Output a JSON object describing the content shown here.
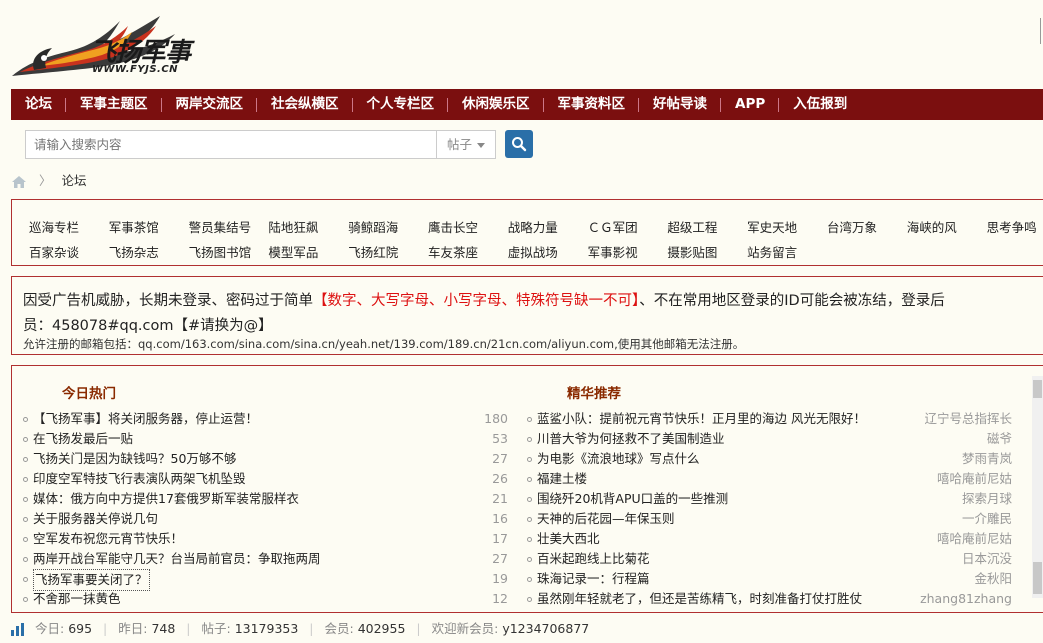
{
  "logo": {
    "title": "飞扬军事",
    "subtitle": "WWW.FYJS.CN"
  },
  "nav": [
    "论坛",
    "军事主题区",
    "两岸交流区",
    "社会纵横区",
    "个人专栏区",
    "休闲娱乐区",
    "军事资料区",
    "好帖导读",
    "APP",
    "入伍报到"
  ],
  "search": {
    "placeholder": "请输入搜索内容",
    "type": "帖子"
  },
  "breadcrumb": {
    "current": "论坛"
  },
  "categories": {
    "row1": [
      "巡海专栏",
      "军事茶馆",
      "警员集结号",
      "陆地狂飙",
      "骑鲸蹈海",
      "鹰击长空",
      "战略力量",
      "ＣＧ军团",
      "超级工程",
      "军史天地",
      "台湾万象",
      "海峡的风",
      "思考争鸣"
    ],
    "row2": [
      "百家杂谈",
      "飞扬杂志",
      "飞扬图书馆",
      "模型军品",
      "飞扬红院",
      "车友茶座",
      "虚拟战场",
      "军事影视",
      "摄影贴图",
      "站务留言"
    ]
  },
  "notice": {
    "line1_pre": "因受广告机威胁，长期未登录、密码过于简单",
    "line1_red": "【数字、大写字母、小写字母、特殊符号缺一不可】",
    "line1_post": "、不在常用地区登录的ID可能会被冻结，登录后",
    "line2": "员：458078#qq.com【#请换为@】",
    "line3": "允许注册的邮箱包括：qq.com/163.com/sina.com/sina.cn/yeah.net/139.com/189.cn/21cn.com/aliyun.com,使用其他邮箱无法注册。"
  },
  "hot": {
    "title": "今日热门",
    "items": [
      {
        "title": "【飞扬军事】将关闭服务器，停止运营！",
        "count": "180"
      },
      {
        "title": "在飞扬发最后一贴",
        "count": "53"
      },
      {
        "title": "飞扬关门是因为缺钱吗？50万够不够",
        "count": "27"
      },
      {
        "title": "印度空军特技飞行表演队两架飞机坠毁",
        "count": "26"
      },
      {
        "title": "媒体：俄方向中方提供17套俄罗斯军装常服样衣",
        "count": "21"
      },
      {
        "title": "关于服务器关停说几句",
        "count": "16"
      },
      {
        "title": "空军发布祝您元宵节快乐！",
        "count": "17"
      },
      {
        "title": "两岸开战台军能守几天？台当局前官员：争取拖两周",
        "count": "27"
      },
      {
        "title": "飞扬军事要关闭了？",
        "count": "19"
      },
      {
        "title": "不舍那一抹黄色",
        "count": "12"
      }
    ]
  },
  "featured": {
    "title": "精华推荐",
    "items": [
      {
        "title": "蓝鲨小队：提前祝元宵节快乐！正月里的海边 风光无限好！",
        "author": "辽宁号总指挥长"
      },
      {
        "title": "川普大爷为何拯救不了美国制造业",
        "author": "磁爷"
      },
      {
        "title": "为电影《流浪地球》写点什么",
        "author": "梦雨青岚"
      },
      {
        "title": "福建土楼",
        "author": "嘻哈庵前尼姑"
      },
      {
        "title": "围绕歼20机背APU口盖的一些推测",
        "author": "探索月球"
      },
      {
        "title": "天神的后花园—年保玉则",
        "author": "一介雕民"
      },
      {
        "title": "壮美大西北",
        "author": "嘻哈庵前尼姑"
      },
      {
        "title": "百米起跑线上比菊花",
        "author": "日本沉没"
      },
      {
        "title": "珠海记录一：行程篇",
        "author": "金秋阳"
      },
      {
        "title": "虽然刚年轻就老了，但还是苦练精飞，时刻准备打仗打胜仗",
        "author": "zhang81zhang"
      }
    ]
  },
  "stats": {
    "today_label": "今日:",
    "today": "695",
    "yesterday_label": "昨日:",
    "yesterday": "748",
    "posts_label": "帖子:",
    "posts": "13179353",
    "members_label": "会员:",
    "members": "402955",
    "newest_label": "欢迎新会员:",
    "newest": "y1234706877"
  },
  "colors": {
    "nav_bg": "#7b0f0f",
    "border": "#b03030",
    "notice_red": "#dd1111",
    "search_btn": "#2a6fa8"
  }
}
